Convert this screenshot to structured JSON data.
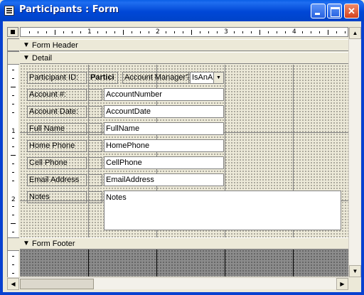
{
  "window": {
    "title": "Participants : Form"
  },
  "ruler": {
    "h_labels": [
      "1",
      "2",
      "3",
      "4"
    ],
    "v_labels": [
      "1",
      "2"
    ]
  },
  "sections": {
    "form_header": "Form Header",
    "detail": "Detail",
    "form_footer": "Form Footer"
  },
  "fields": {
    "participant_id_label": "Participant ID:",
    "participant_id_value": "Partici",
    "account_manager_label": "Account Manager?",
    "account_manager_value": "IsAnA",
    "account_number_label": "Account #:",
    "account_number_value": "AccountNumber",
    "account_date_label": "Account Date:",
    "account_date_value": "AccountDate",
    "full_name_label": "Full Name",
    "full_name_value": "FullName",
    "home_phone_label": "Home Phone",
    "home_phone_value": "HomePhone",
    "cell_phone_label": "Cell Phone",
    "cell_phone_value": "CellPhone",
    "email_label": "Email Address",
    "email_value": "EmailAddress",
    "notes_label": "Notes",
    "notes_value": "Notes"
  },
  "colors": {
    "titlebar": "#0a5fe6",
    "frame": "#0841d0",
    "surface": "#ece9d8"
  },
  "icons": {
    "app": "form-icon",
    "minimize": "minimize-icon",
    "maximize": "maximize-icon",
    "close": "close-icon",
    "section": "section-arrow-icon",
    "dropdown": "chevron-down-icon"
  }
}
